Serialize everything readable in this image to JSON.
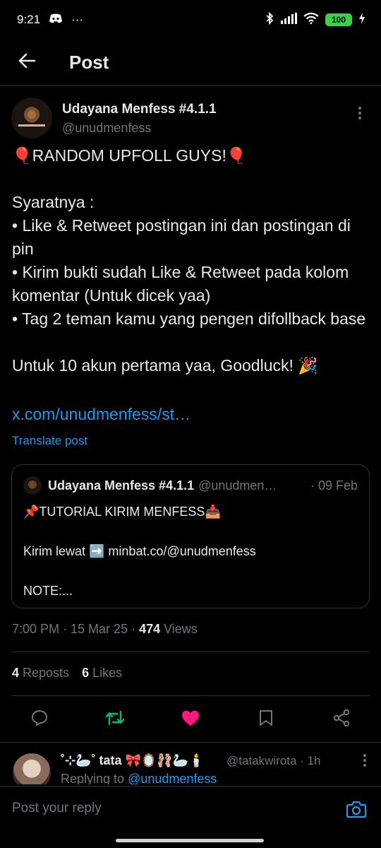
{
  "status_bar": {
    "time": "9:21",
    "dots": "···",
    "battery": "100",
    "icons": [
      "discord-icon",
      "bluetooth-icon",
      "signal-icon",
      "wifi-icon",
      "battery-icon",
      "charging-icon"
    ]
  },
  "header": {
    "title": "Post",
    "back_icon": "arrow-left-icon"
  },
  "post": {
    "author_name": "Udayana Menfess #4.1.1",
    "author_handle": "@unudmenfess",
    "body": "🎈RANDOM UPFOLL GUYS!🎈\n\nSyaratnya :\n• Like & Retweet postingan ini dan postingan di pin\n• Kirim bukti sudah Like & Retweet pada kolom komentar (Untuk dicek yaa)\n• Tag 2 teman kamu yang pengen difollback base\n\nUntuk 10 akun pertama yaa, Goodluck! 🎉",
    "link": "x.com/unudmenfess/st…",
    "translate_label": "Translate post"
  },
  "quote": {
    "author_name": "Udayana Menfess #4.1.1",
    "author_handle": "@unudmenfess",
    "date": "· 09 Feb",
    "text": "📌TUTORIAL KIRIM MENFESS📥\n\nKirim lewat ➡️ minbat.co/@unudmenfess\n\nNOTE:..."
  },
  "meta": {
    "timestamp": "7:00 PM · 15 Mar 25 · ",
    "views_count": "474",
    "views_label": " Views"
  },
  "stats": {
    "reposts_count": "4",
    "reposts_label": " Reposts",
    "likes_count": "6",
    "likes_label": " Likes"
  },
  "actions": {
    "icons": [
      "reply-icon",
      "repost-icon",
      "like-icon",
      "bookmark-icon",
      "share-icon"
    ],
    "colors": {
      "repost": "#00ba7c",
      "like": "#f91880",
      "default": "#71767b"
    }
  },
  "reply": {
    "author_name": "˚⊹🦢˚ tata 🎀🪞🩰🦢🕯️",
    "author_handle": "@tatakwirota · 1h",
    "replying_prefix": "Replying to ",
    "replying_handle": "@unudmenfess"
  },
  "reply_bar": {
    "placeholder": "Post your reply",
    "camera_icon": "camera-icon"
  },
  "colors": {
    "background": "#000000",
    "text": "#e7e9ea",
    "secondary": "#71767b",
    "accent": "#1d9bf0",
    "border": "#2f3336"
  }
}
